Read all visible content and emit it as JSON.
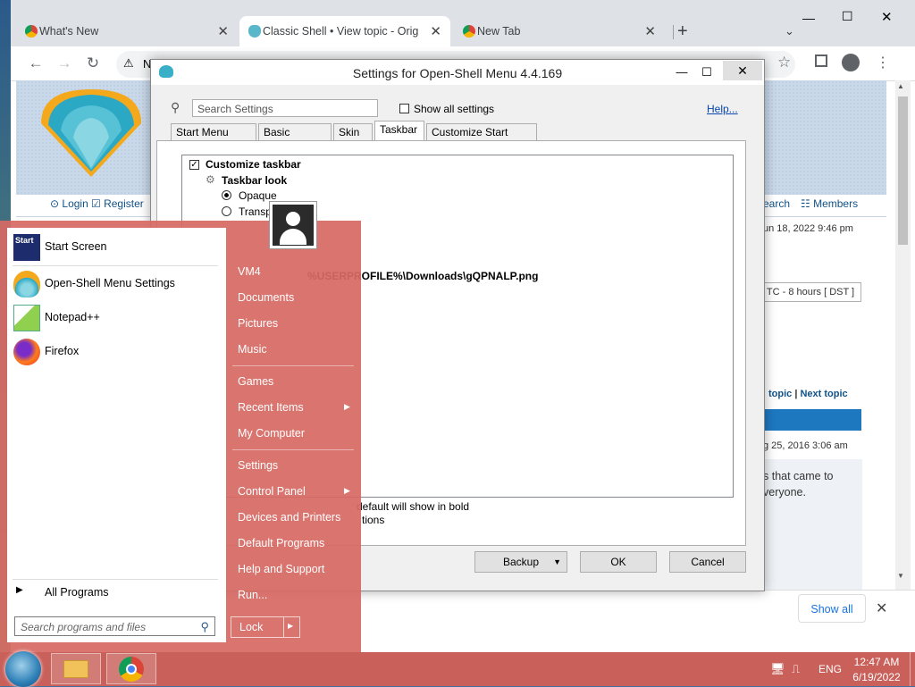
{
  "browser": {
    "tabs": [
      {
        "label": "What's New"
      },
      {
        "label": "Classic Shell • View topic - Origin"
      },
      {
        "label": "New Tab"
      }
    ],
    "new_tab_glyph": "+",
    "address_prefix": "N"
  },
  "forum": {
    "nav": {
      "login": "Login",
      "register": "Register",
      "search": "earch",
      "members": "Members"
    },
    "date_current": "un 18, 2022 9:46 pm",
    "timezone": "TC - 8 hours [ DST ]",
    "topic_nav": {
      "prev": "topic",
      "sep": "|",
      "next": "Next topic"
    },
    "post_date": "g 25, 2016 3:06 am",
    "post_text_1": "s that came to",
    "post_text_2": "veryone.",
    "show_all": "Show all"
  },
  "settings_dialog": {
    "title": "Settings for Open-Shell Menu 4.4.169",
    "search_placeholder": "Search Settings",
    "show_all_label": "Show all settings",
    "help_label": "Help...",
    "tabs": [
      "Start Menu Style",
      "Basic Settings",
      "Skin",
      "Taskbar",
      "Customize Start Menu"
    ],
    "active_tab": "Taskbar",
    "tree": {
      "customize_taskbar": "Customize taskbar",
      "taskbar_look": "Taskbar look",
      "opaque": "Opaque",
      "transparent_partial": "Transp",
      "texture_path": "%USERPROFILE%\\Downloads\\gQPNALP.png"
    },
    "hint_1": "default will show in bold",
    "hint_2": "tions",
    "buttons": {
      "backup": "Backup",
      "ok": "OK",
      "cancel": "Cancel"
    }
  },
  "start_menu": {
    "left_items": [
      {
        "label": "Start Screen",
        "icon": "start-screen-icon"
      },
      {
        "label": "Open-Shell Menu Settings",
        "icon": "open-shell-icon"
      },
      {
        "label": "Notepad++",
        "icon": "notepadpp-icon"
      },
      {
        "label": "Firefox",
        "icon": "firefox-icon"
      }
    ],
    "start_icon_text": "Start",
    "all_programs": "All Programs",
    "search_placeholder": "Search programs and files",
    "right_items": [
      "VM4",
      "Documents",
      "Pictures",
      "Music",
      "Games",
      "Recent Items",
      "My Computer",
      "Settings",
      "Control Panel",
      "Devices and Printers",
      "Default Programs",
      "Help and Support",
      "Run..."
    ],
    "lock_label": "Lock"
  },
  "taskbar": {
    "language": "ENG",
    "time": "12:47 AM",
    "date": "6/19/2022"
  },
  "colors": {
    "startmenu_bg": "#d66964",
    "taskbar_bg": "#c9605a",
    "link_blue": "#105289"
  }
}
